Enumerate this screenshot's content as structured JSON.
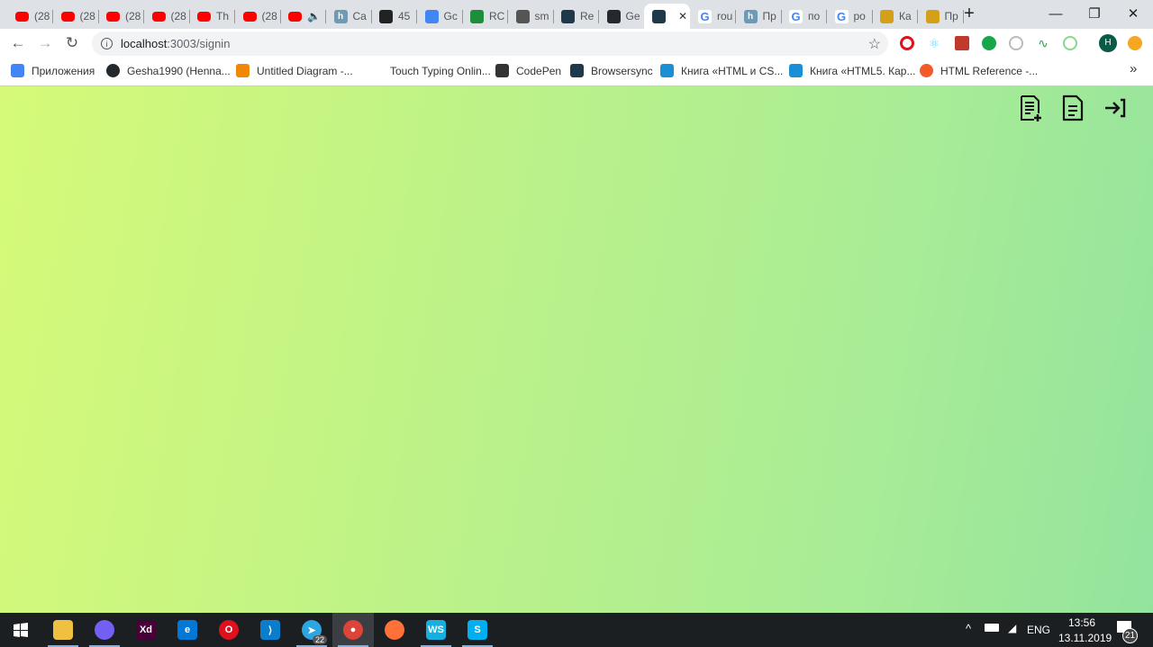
{
  "tabs": [
    {
      "label": "(28",
      "icon": "youtube-icon"
    },
    {
      "label": "(28",
      "icon": "youtube-icon"
    },
    {
      "label": "(28",
      "icon": "youtube-icon"
    },
    {
      "label": "(28",
      "icon": "youtube-icon"
    },
    {
      "label": "Th",
      "icon": "youtube-icon"
    },
    {
      "label": "(28",
      "icon": "youtube-icon"
    },
    {
      "label": "🔈",
      "icon": "youtube-icon"
    },
    {
      "label": "Ca",
      "icon": "habr-icon"
    },
    {
      "label": "45",
      "icon": "cat-icon"
    },
    {
      "label": "Gc",
      "icon": "google-translate-icon"
    },
    {
      "label": "RC",
      "icon": "green-face-icon"
    },
    {
      "label": "sm",
      "icon": "globe-icon"
    },
    {
      "label": "Re",
      "icon": "react-icon"
    },
    {
      "label": "Ge",
      "icon": "github-icon"
    },
    {
      "label": "",
      "icon": "react-icon",
      "active": true
    },
    {
      "label": "rou",
      "icon": "google-icon"
    },
    {
      "label": "Пр",
      "icon": "habr-icon"
    },
    {
      "label": "по",
      "icon": "google-icon"
    },
    {
      "label": "ро",
      "icon": "google-icon"
    },
    {
      "label": "Ка",
      "icon": "glasses-icon"
    },
    {
      "label": "Пр",
      "icon": "glasses-icon"
    }
  ],
  "window": {
    "new_tab": "+",
    "minimize": "—",
    "restore": "❐",
    "close": "✕",
    "tab_close": "✕"
  },
  "address": {
    "host": "localhost",
    "path": ":3003/signin"
  },
  "profile_initial": "H",
  "bookmarks": [
    {
      "label": "Приложения",
      "icon": "apps-icon",
      "color": "#4285f4"
    },
    {
      "label": "Gesha1990 (Henna...",
      "icon": "github-icon",
      "color": "#24292e"
    },
    {
      "label": "Untitled Diagram -...",
      "icon": "drawio-icon",
      "color": "#f08705"
    },
    {
      "label": "Touch Typing Onlin...",
      "icon": "blank-icon",
      "color": "#ffffff"
    },
    {
      "label": "CodePen",
      "icon": "codepen-icon",
      "color": "#333333"
    },
    {
      "label": "Browsersync",
      "icon": "react-icon",
      "color": "#1e3a4a"
    },
    {
      "label": "Книга «HTML и CS...",
      "icon": "book-icon",
      "color": "#1a8fd6"
    },
    {
      "label": "Книга «HTML5. Кар...",
      "icon": "book-icon",
      "color": "#1a8fd6"
    },
    {
      "label": "HTML Reference -...",
      "icon": "html-ref-icon",
      "color": "#f25a29"
    }
  ],
  "bookmarks_more": "»",
  "colors": {
    "gradient_start": "#d6fa78",
    "gradient_end": "#93e39e"
  },
  "taskbar": {
    "apps": [
      {
        "name": "file-explorer",
        "color": "#f0c040",
        "label": ""
      },
      {
        "name": "viber",
        "color": "#7360f2",
        "label": ""
      },
      {
        "name": "adobe-xd",
        "color": "#470137",
        "label": "Xd"
      },
      {
        "name": "edge",
        "color": "#0078d7",
        "label": "e"
      },
      {
        "name": "opera",
        "color": "#e0101e",
        "label": "O"
      },
      {
        "name": "vscode",
        "color": "#0a7ecc",
        "label": "⟩"
      },
      {
        "name": "telegram",
        "color": "#2ca5e0",
        "label": "➤",
        "badge": "22"
      },
      {
        "name": "chrome",
        "color": "#db4437",
        "label": "●",
        "active": true
      },
      {
        "name": "firefox",
        "color": "#ff7139",
        "label": ""
      },
      {
        "name": "webstorm",
        "color": "#16b0e0",
        "label": "WS"
      },
      {
        "name": "skype",
        "color": "#00aff0",
        "label": "S"
      }
    ],
    "language": "ENG",
    "time": "13:56",
    "date": "13.11.2019",
    "notifications": "21"
  }
}
